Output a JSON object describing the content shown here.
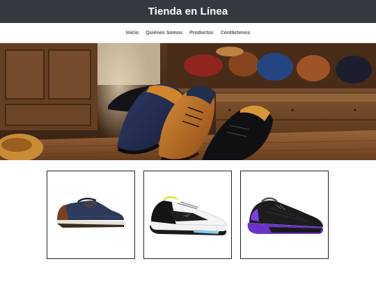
{
  "header": {
    "title": "Tienda en Línea"
  },
  "nav": {
    "items": [
      {
        "label": "Inicio"
      },
      {
        "label": "Quiénes Somos"
      },
      {
        "label": "Productos"
      },
      {
        "label": "Contáctenos"
      }
    ]
  },
  "hero": {
    "icon": "shoe-shop-photo"
  },
  "products": [
    {
      "icon": "casual-shoe-navy-icon"
    },
    {
      "icon": "running-shoe-white-icon"
    },
    {
      "icon": "running-shoe-purple-icon"
    }
  ],
  "colors": {
    "header_bg": "#343a40",
    "header_text": "#ffffff",
    "nav_text": "#555555",
    "card_border": "#222222"
  }
}
